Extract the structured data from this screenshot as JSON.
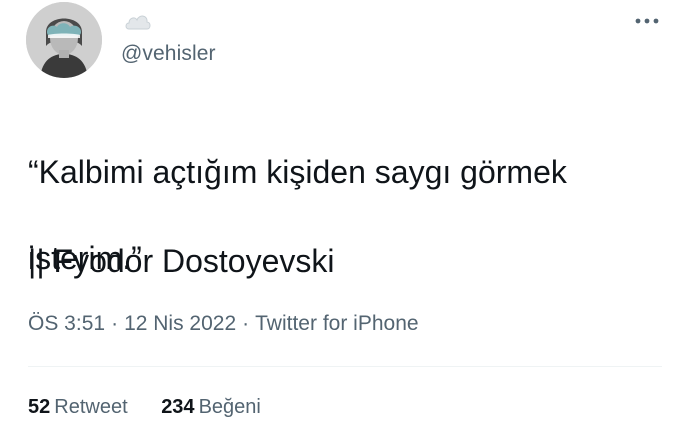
{
  "tweet": {
    "handle": "@vehisler",
    "text_line1": "“Kalbimi açtığım kişiden saygı görmek",
    "text_line2": "isterim.”",
    "attribution": "|| Fyodor Dostoyevski",
    "time": "ÖS 3:51",
    "separator": "·",
    "date": "12 Nis 2022",
    "source": "Twitter for iPhone"
  },
  "stats": {
    "retweets_count": "52",
    "retweets_label": "Retweet",
    "likes_count": "234",
    "likes_label": "Beğeni"
  },
  "colors": {
    "text": "#0f1419",
    "secondary": "#536471",
    "divider": "#eff3f4"
  },
  "icons": {
    "profile_emoji": "cloud-icon",
    "more": "more-dots-icon"
  }
}
